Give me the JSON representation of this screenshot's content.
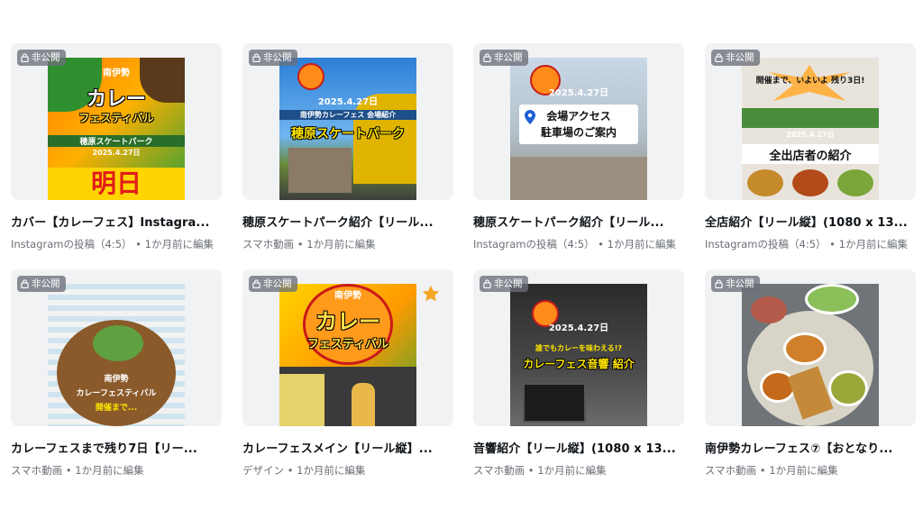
{
  "cards": [
    {
      "badge": "非公開",
      "title": "カバー【カレーフェス】Instagra...",
      "type": "Instagramの投稿（4:5）",
      "edited": "1か月前に編集",
      "thumb_text": [
        "南伊勢",
        "カレー",
        "フェスティバル",
        "穂原スケートパーク",
        "2025.4.27日",
        "明日"
      ]
    },
    {
      "badge": "非公開",
      "title": "穂原スケートパーク紹介【リール...",
      "type": "スマホ動画",
      "edited": "1か月前に編集",
      "thumb_text": [
        "2025.4.27日",
        "南伊勢カレーフェス 会場紹介",
        "穂原スケートパーク"
      ]
    },
    {
      "badge": "非公開",
      "title": "穂原スケートパーク紹介【リール...",
      "type": "Instagramの投稿（4:5）",
      "edited": "1か月前に編集",
      "thumb_text": [
        "2025.4.27日",
        "会場アクセス",
        "駐車場のご案内"
      ]
    },
    {
      "badge": "非公開",
      "title": "全店紹介【リール縦】(1080 x 13...",
      "type": "Instagramの投稿（4:5）",
      "edited": "1か月前に編集",
      "thumb_text": [
        "開催まで、いよいよ 残り3日!",
        "2025.4.27日",
        "全出店者の紹介"
      ]
    },
    {
      "badge": "非公開",
      "title": "カレーフェスまで残り7日【リー...",
      "type": "スマホ動画",
      "edited": "1か月前に編集",
      "thumb_text": [
        "南伊勢",
        "カレーフェスティバル",
        "開催まで..."
      ]
    },
    {
      "badge": "非公開",
      "title": "カレーフェスメイン【リール縦】...",
      "type": "デザイン",
      "edited": "1か月前に編集",
      "thumb_text": [
        "南伊勢",
        "カレー",
        "フェスティバル"
      ]
    },
    {
      "badge": "非公開",
      "title": "音響紹介【リール縦】(1080 x 13...",
      "type": "スマホ動画",
      "edited": "1か月前に編集",
      "thumb_text": [
        "2025.4.27日",
        "誰でもカレーを味わえる!?",
        "カレーフェス音響 紹介"
      ]
    },
    {
      "badge": "非公開",
      "title": "南伊勢カレーフェス⑦【おとなり...",
      "type": "スマホ動画",
      "edited": "1か月前に編集",
      "thumb_text": []
    }
  ],
  "separator": " • ",
  "colors": {
    "badge_bg": "#6c7078",
    "meta": "#6b6f76",
    "card_bg": "#f1f2f4",
    "star": "#f5a623"
  }
}
